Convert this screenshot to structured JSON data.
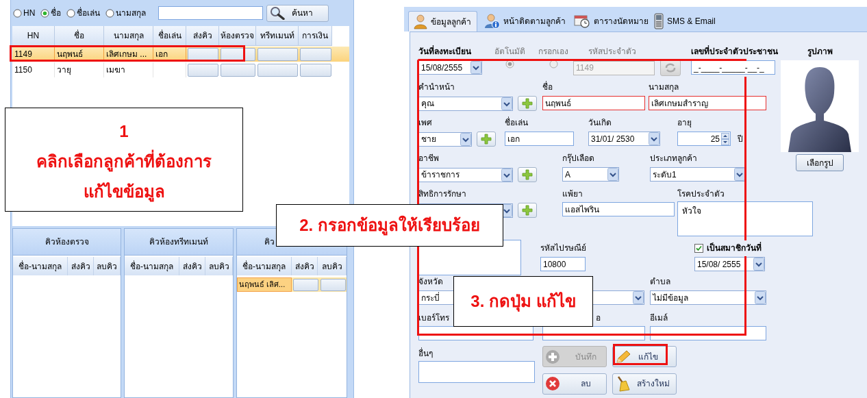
{
  "search": {
    "options": [
      {
        "label": "HN",
        "selected": false
      },
      {
        "label": "ชื่อ",
        "selected": true
      },
      {
        "label": "ชื่อเล่น",
        "selected": false
      },
      {
        "label": "นามสกุล",
        "selected": false
      }
    ],
    "button": "ค้นหา"
  },
  "customers": {
    "columns": [
      "HN",
      "ชื่อ",
      "นามสกุล",
      "ชื่อเล่น",
      "ส่งคิว",
      "ห้องตรวจ",
      "ทรีทเมนท์",
      "การเงิน"
    ],
    "rows": [
      {
        "hn": "1149",
        "first_name": "นฤพนธ์",
        "last_name": "เลิศเกษม ...",
        "nickname": "เอก",
        "selected": true
      },
      {
        "hn": "1150",
        "first_name": "วายุ",
        "last_name": "เมฆา",
        "selected": false
      }
    ]
  },
  "queues": [
    {
      "title": "คิวห้องตรวจ",
      "columns": [
        "ชื่อ-นามสกุล",
        "ส่งคิว",
        "ลบคิว"
      ]
    },
    {
      "title": "คิวห้องทรีทเมนท์",
      "columns": [
        "ชื่อ-นามสกุล",
        "ส่งคิว",
        "ลบคิว"
      ]
    },
    {
      "title": "คิว",
      "columns": [
        "ชื่อ-นามสกุล",
        "ส่งคิว",
        "ลบคิว"
      ],
      "rows": [
        {
          "name": "นฤพนธ์ เลิศ...",
          "selected": true
        }
      ]
    }
  ],
  "tabs": [
    {
      "label": "ข้อมูลลูกค้า",
      "selected": true
    },
    {
      "label": "หน้าติดตามลูกค้า",
      "selected": false
    },
    {
      "label": "ตารางนัดหมาย",
      "selected": false
    },
    {
      "label": "SMS & Email",
      "selected": false
    }
  ],
  "form": {
    "registration_date": {
      "label": "วันที่ลงทะเบียน",
      "value": "15/08/2555"
    },
    "id_modes": [
      {
        "label": "อัตโนมัติ",
        "selected": true
      },
      {
        "label": "กรอกเอง",
        "selected": false
      }
    ],
    "customer_id": {
      "label": "รหัสประจำตัว",
      "value": "1149",
      "disabled": true
    },
    "national_id": {
      "label": "เลขที่ประจำตัวประชาชน",
      "value": "_-____-_____-__-_"
    },
    "photo": {
      "label": "รูปภาพ",
      "button": "เลือกรูป"
    },
    "title": {
      "label": "คำนำหน้า",
      "value": "คุณ"
    },
    "first_name": {
      "label": "ชื่อ",
      "value": "นฤพนธ์",
      "required": true
    },
    "last_name": {
      "label": "นามสกุล",
      "value": "เลิศเกษมสำราญ",
      "required": true
    },
    "gender": {
      "label": "เพศ",
      "value": "ชาย"
    },
    "nickname": {
      "label": "ชื่อเล่น",
      "value": "เอก"
    },
    "birth_date": {
      "label": "วันเกิด",
      "value": "31/01/  2530"
    },
    "age": {
      "label": "อายุ",
      "value": "25",
      "unit": "ปี"
    },
    "occupation": {
      "label": "อาชีพ",
      "value": "ข้าราชการ"
    },
    "blood_group": {
      "label": "กรุ๊ปเลือด",
      "value": "A"
    },
    "customer_type": {
      "label": "ประเภทลูกค้า",
      "value": "ระดับ1"
    },
    "treatment_right": {
      "label": "สิทธิการรักษา"
    },
    "drug_allergy": {
      "label": "แพ้ยา",
      "value": "แอสไพริน"
    },
    "disease": {
      "label": "โรคประจำตัว",
      "value": "หัวใจ"
    },
    "postal_code": {
      "label": "รหัสไปรษณีย์",
      "value": "10800"
    },
    "member": {
      "label": "เป็นสมาชิกวันที่",
      "checked": true,
      "value": "15/08/  2555"
    },
    "province": {
      "label": "จังหวัด",
      "value": "กระบี่"
    },
    "subdistrict": {
      "label": "ตำบล",
      "value": "ไม่มีข้อมูล"
    },
    "phone": {
      "label": "เบอร์โทร"
    },
    "field_2": {
      "label": "อ"
    },
    "email": {
      "label": "อีเมล์"
    },
    "other": {
      "label": "อื่นๆ"
    },
    "buttons": [
      {
        "kind": "save",
        "label": "บันทึก",
        "disabled": true
      },
      {
        "kind": "edit",
        "label": "แก้ไข",
        "disabled": false
      },
      {
        "kind": "delete",
        "label": "ลบ",
        "disabled": false
      },
      {
        "kind": "new",
        "label": "สร้างใหม่",
        "disabled": false
      }
    ]
  },
  "callouts": [
    {
      "lines": [
        "1",
        "คลิกเลือกลูกค้าที่ต้องการ",
        "แก้ไขข้อมูล"
      ]
    },
    {
      "lines": [
        "2. กรอกข้อมูลให้เรียบร้อย"
      ]
    },
    {
      "lines": [
        "3. กดปุ่ม แก้ไข"
      ]
    }
  ]
}
